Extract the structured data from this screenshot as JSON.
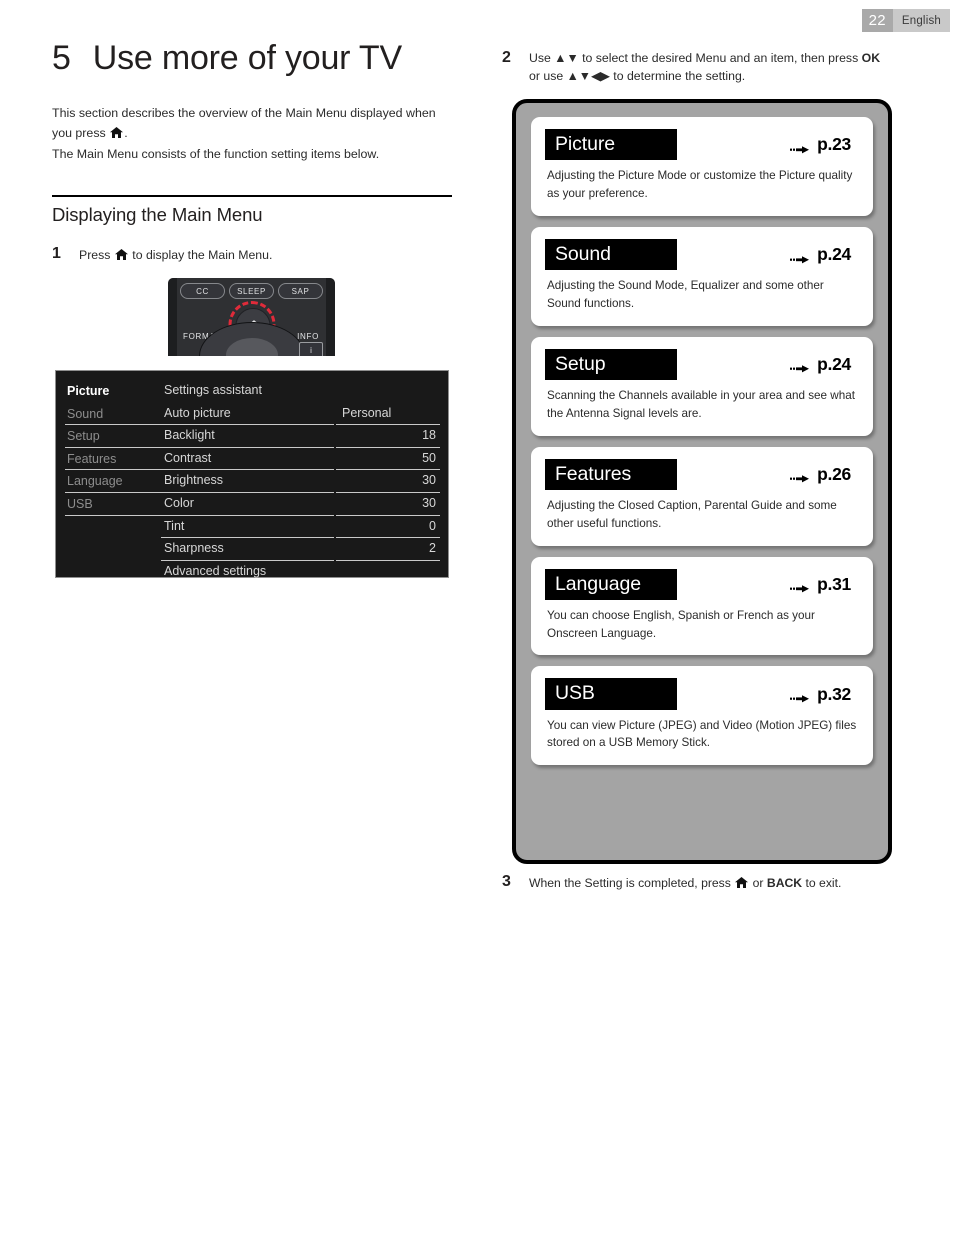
{
  "header": {
    "page_number": "22",
    "language": "English"
  },
  "chapter": {
    "number": "5",
    "title": "Use more of your TV",
    "intro_line1": "This section describes the overview of the Main Menu displayed when",
    "intro_line2_prefix": "you press",
    "intro_line2_suffix": ".",
    "intro_line3": "The Main Menu consists of the function setting items below."
  },
  "section": {
    "title": "Displaying the Main Menu"
  },
  "steps": {
    "one": {
      "number": "1",
      "text_before_icon": "Press",
      "text_after_icon": "to display the Main Menu."
    },
    "two": {
      "number": "2",
      "line1_a": "Use",
      "line1_arrows": "▲▼",
      "line1_b": "to select the desired Menu and an item, then press",
      "line1_ok": "OK",
      "line2_a": "or use",
      "line2_arrows": "▲▼◀▶",
      "line2_b": "to determine the setting."
    },
    "three": {
      "number": "3",
      "text_before_icon": "When the Setting is completed, press",
      "text_middle": "or",
      "back_label": "BACK",
      "text_after": "to exit."
    }
  },
  "remote": {
    "buttons": [
      "CC",
      "SLEEP",
      "SAP"
    ],
    "format_label": "FORMAT",
    "info_label": "INFO",
    "info_button_glyph": "i",
    "highlight_color": "#e02b3a"
  },
  "tv_menu": {
    "nav": [
      {
        "label": "Picture",
        "active": true
      },
      {
        "label": "Sound",
        "active": false
      },
      {
        "label": "Setup",
        "active": false
      },
      {
        "label": "Features",
        "active": false
      },
      {
        "label": "Language",
        "active": false
      },
      {
        "label": "USB",
        "active": false
      }
    ],
    "rows": [
      {
        "label": "Settings assistant",
        "value": ""
      },
      {
        "label": "Auto picture",
        "value": "Personal"
      },
      {
        "label": "Backlight",
        "value": "18"
      },
      {
        "label": "Contrast",
        "value": "50"
      },
      {
        "label": "Brightness",
        "value": "30"
      },
      {
        "label": "Color",
        "value": "30"
      },
      {
        "label": "Tint",
        "value": "0"
      },
      {
        "label": "Sharpness",
        "value": "2"
      },
      {
        "label": "Advanced settings",
        "value": ""
      }
    ]
  },
  "panels": [
    {
      "title": "Picture",
      "page_ref": "p.23",
      "desc_line1": "Adjusting the Picture Mode or customize the Picture quality",
      "desc_line2": "as your preference."
    },
    {
      "title": "Sound",
      "page_ref": "p.24",
      "desc_line1": "Adjusting the Sound Mode, Equalizer and some other",
      "desc_line2": "Sound functions."
    },
    {
      "title": "Setup",
      "page_ref": "p.24",
      "desc_line1": "Scanning the Channels available in your area and see what",
      "desc_line2": "the Antenna Signal levels are."
    },
    {
      "title": "Features",
      "page_ref": "p.26",
      "desc_line1": "Adjusting the Closed Caption, Parental Guide and some",
      "desc_line2": "other useful functions."
    },
    {
      "title": "Language",
      "page_ref": "p.31",
      "desc_line1": "You can choose English, Spanish or French as your",
      "desc_line2": "Onscreen Language."
    },
    {
      "title": "USB",
      "page_ref": "p.32",
      "desc_line1": "You can view Picture (JPEG) and Video (Motion JPEG) files",
      "desc_line2": "stored on a USB Memory Stick."
    }
  ]
}
